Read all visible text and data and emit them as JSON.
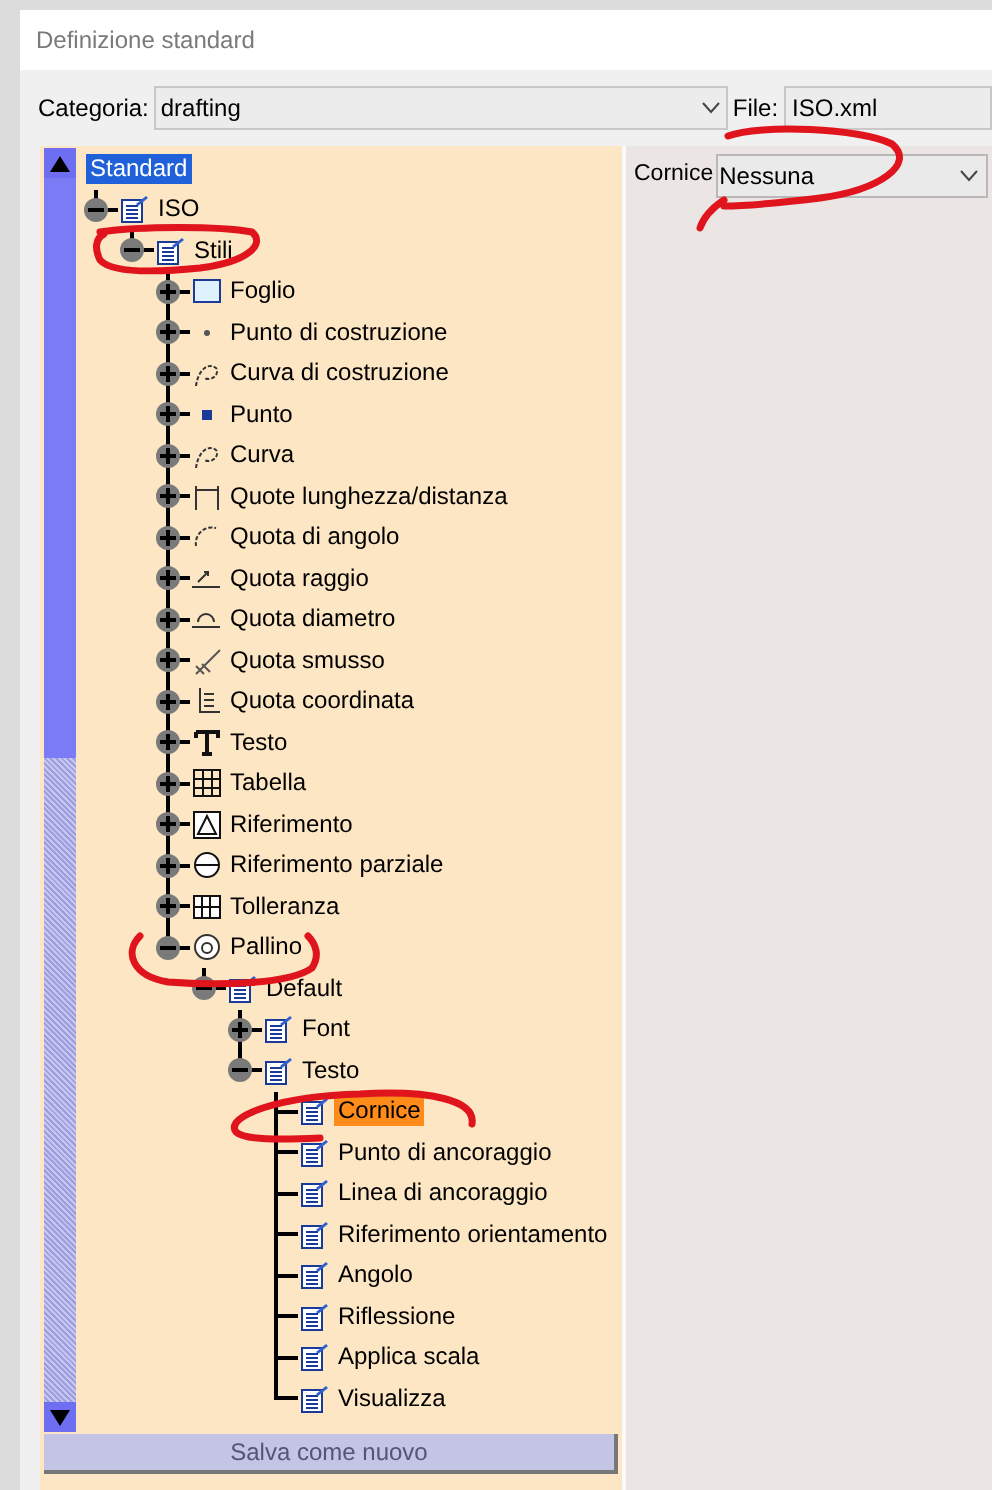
{
  "window": {
    "title": "Definizione standard"
  },
  "category": {
    "label": "Categoria:",
    "value": "drafting"
  },
  "file": {
    "label": "File:",
    "value": "ISO.xml"
  },
  "tree": [
    {
      "label": "Standard",
      "selected": false,
      "focused": true,
      "children": [
        {
          "label": "ISO",
          "kind": "style",
          "expanded": true,
          "selected": false,
          "children": [
            {
              "label": "Stili",
              "kind": "style",
              "expanded": true,
              "selected": false,
              "children": [
                {
                  "label": "Foglio",
                  "kind": "sheet",
                  "expanded": false,
                  "selected": false
                },
                {
                  "label": "Punto di costruzione",
                  "kind": "dot",
                  "expanded": false,
                  "selected": false
                },
                {
                  "label": "Curva di costruzione",
                  "kind": "curve",
                  "expanded": false,
                  "selected": false
                },
                {
                  "label": "Punto",
                  "kind": "point",
                  "expanded": false,
                  "selected": false
                },
                {
                  "label": "Curva",
                  "kind": "curve",
                  "expanded": false,
                  "selected": false
                },
                {
                  "label": "Quote lunghezza/distanza",
                  "kind": "dimension",
                  "expanded": false,
                  "selected": false
                },
                {
                  "label": "Quota di angolo",
                  "kind": "angle",
                  "expanded": false,
                  "selected": false
                },
                {
                  "label": "Quota raggio",
                  "kind": "radius",
                  "expanded": false,
                  "selected": false
                },
                {
                  "label": "Quota diametro",
                  "kind": "diameter",
                  "expanded": false,
                  "selected": false
                },
                {
                  "label": "Quota smusso",
                  "kind": "chamfer",
                  "expanded": false,
                  "selected": false
                },
                {
                  "label": "Quota coordinata",
                  "kind": "coordinate",
                  "expanded": false,
                  "selected": false
                },
                {
                  "label": "Testo",
                  "kind": "text",
                  "expanded": false,
                  "selected": false
                },
                {
                  "label": "Tabella",
                  "kind": "table",
                  "expanded": false,
                  "selected": false
                },
                {
                  "label": "Riferimento",
                  "kind": "datum",
                  "expanded": false,
                  "selected": false
                },
                {
                  "label": "Riferimento parziale",
                  "kind": "section",
                  "expanded": false,
                  "selected": false
                },
                {
                  "label": "Tolleranza",
                  "kind": "tolerance",
                  "expanded": false,
                  "selected": false
                },
                {
                  "label": "Pallino",
                  "kind": "balloon",
                  "expanded": true,
                  "selected": false,
                  "children": [
                    {
                      "label": "Default",
                      "kind": "list",
                      "expanded": true,
                      "selected": false,
                      "children": [
                        {
                          "label": "Font",
                          "kind": "style",
                          "expanded": false,
                          "selected": false
                        },
                        {
                          "label": "Testo",
                          "kind": "style",
                          "expanded": true,
                          "selected": false,
                          "children": [
                            {
                              "label": "Cornice",
                              "kind": "style",
                              "selected": true
                            },
                            {
                              "label": "Punto di ancoraggio",
                              "kind": "style",
                              "selected": false
                            },
                            {
                              "label": "Linea di ancoraggio",
                              "kind": "style",
                              "selected": false
                            },
                            {
                              "label": "Riferimento orientamento",
                              "kind": "style",
                              "selected": false
                            },
                            {
                              "label": "Angolo",
                              "kind": "style",
                              "selected": false
                            },
                            {
                              "label": "Riflessione",
                              "kind": "style",
                              "selected": false
                            },
                            {
                              "label": "Applica scala",
                              "kind": "style",
                              "selected": false
                            },
                            {
                              "label": "Visualizza",
                              "kind": "style",
                              "selected": false
                            }
                          ]
                        }
                      ]
                    }
                  ]
                }
              ]
            }
          ]
        }
      ]
    }
  ],
  "save_button": {
    "label": "Salva come nuovo",
    "disabled": true
  },
  "property": {
    "label": "Cornice",
    "value": "Nessuna"
  }
}
